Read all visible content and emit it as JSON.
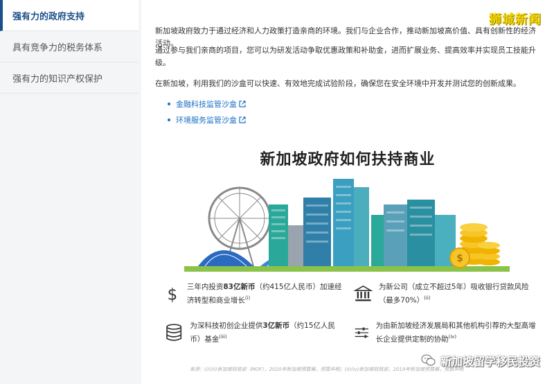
{
  "sidebar": {
    "items": [
      {
        "label": "强有力的政府支持",
        "active": true
      },
      {
        "label": "具有竞争力的税务体系",
        "active": false
      },
      {
        "label": "强有力的知识产权保护",
        "active": false
      }
    ]
  },
  "main": {
    "paragraphs": [
      "新加坡政府致力于通过经济和人力政策打造亲商的环境。我们与企业合作，推动新加坡高价值、具有创新性的经济活动。",
      "通过参与我们亲商的项目，您可以为研发活动争取优惠政策和补助金，进而扩展业务、提高效率并实现员工技能升级。",
      "在新加坡，利用我们的沙盒可以快速、有效地完成试验阶段，确保您在安全环境中开发并测试您的创新成果。"
    ],
    "links": [
      "金融科技监管沙盒",
      "环境服务监管沙盒"
    ]
  },
  "infographic": {
    "title": "新加坡政府如何扶持商业",
    "features": {
      "f1_pre": "三年内投资",
      "f1_bold": "83亿新币",
      "f1_post": "（约415亿人民币）加速经济转型和商业增长",
      "f1_sup": "(i)",
      "f2_text": "为新公司（成立不超过5年）吸收银行贷款风险（最多70%）",
      "f2_sup": "(ii)",
      "f3_pre": "为深科技初创企业提供",
      "f3_bold": "3亿新币",
      "f3_post": "（约15亿人民币）基金",
      "f3_sup": "(iii)",
      "f4_text": "为由新加坡经济发展局和其他机构引荐的大型高增长企业提供定制的协助",
      "f4_sup": "(iv)"
    },
    "source": "来源：(i)(iii)新加坡财政部（MOF），2020年新加坡预算案，预算声明；(ii)(iv)新加坡财政部，2019年新加坡预算案，预算声明"
  },
  "watermarks": {
    "top": "狮城新闻",
    "bottom": "新加坡留学移民投资"
  }
}
